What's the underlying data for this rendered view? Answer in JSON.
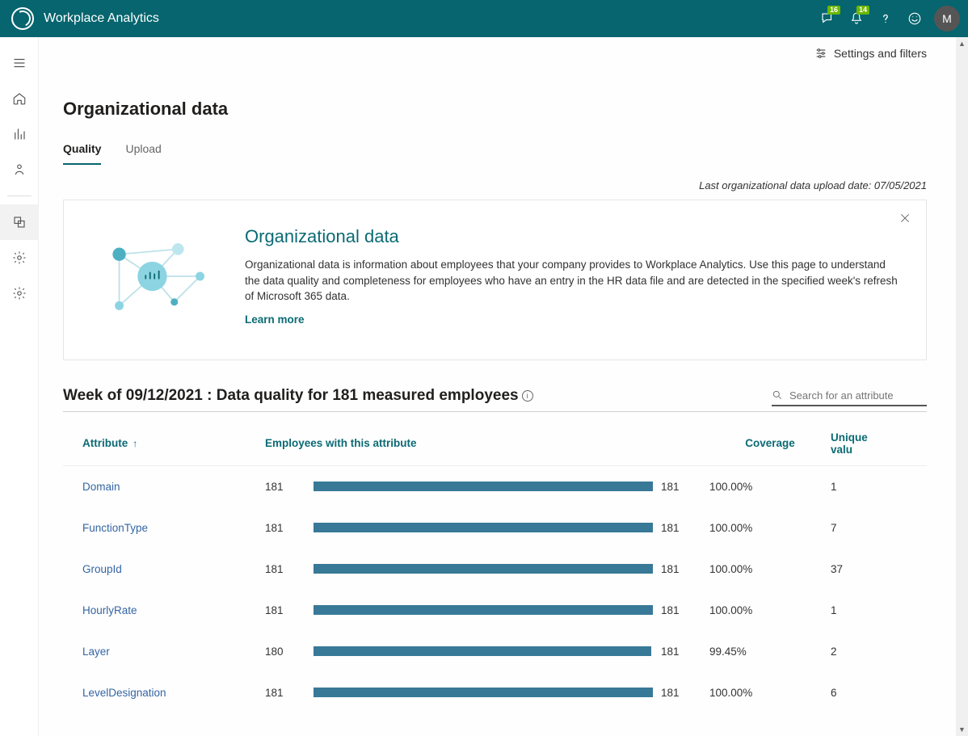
{
  "app_name": "Workplace Analytics",
  "topbar": {
    "messages_badge": "16",
    "notif_badge": "14",
    "avatar_initial": "M"
  },
  "settings_link": "Settings and filters",
  "page_title": "Organizational data",
  "tabs": {
    "quality": "Quality",
    "upload": "Upload"
  },
  "upload_date_line": "Last organizational data upload date: 07/05/2021",
  "info_card": {
    "heading": "Organizational data",
    "body": "Organizational data is information about employees that your company provides to Workplace Analytics. Use this page to understand the data quality and completeness for employees who have an entry in the HR data file and are detected in the specified week's refresh of Microsoft 365 data.",
    "learn_more": "Learn more"
  },
  "section_heading": "Week of 09/12/2021 :  Data quality for 181 measured employees",
  "search_placeholder": "Search for an attribute",
  "table_headers": {
    "attribute": "Attribute",
    "employees": "Employees with this attribute",
    "coverage": "Coverage",
    "unique": "Unique valu"
  },
  "rows": [
    {
      "attribute": "Domain",
      "count": "181",
      "bar_pct": 100,
      "bar_label": "181",
      "coverage": "100.00%",
      "unique": "1"
    },
    {
      "attribute": "FunctionType",
      "count": "181",
      "bar_pct": 100,
      "bar_label": "181",
      "coverage": "100.00%",
      "unique": "7"
    },
    {
      "attribute": "GroupId",
      "count": "181",
      "bar_pct": 100,
      "bar_label": "181",
      "coverage": "100.00%",
      "unique": "37"
    },
    {
      "attribute": "HourlyRate",
      "count": "181",
      "bar_pct": 100,
      "bar_label": "181",
      "coverage": "100.00%",
      "unique": "1"
    },
    {
      "attribute": "Layer",
      "count": "180",
      "bar_pct": 99.45,
      "bar_label": "181",
      "coverage": "99.45%",
      "unique": "2"
    },
    {
      "attribute": "LevelDesignation",
      "count": "181",
      "bar_pct": 100,
      "bar_label": "181",
      "coverage": "100.00%",
      "unique": "6"
    }
  ],
  "chart_data": {
    "type": "bar",
    "title": "Data quality for 181 measured employees (Week of 09/12/2021)",
    "xlabel": "Employees with this attribute",
    "ylabel": "Attribute",
    "xlim": [
      0,
      181
    ],
    "categories": [
      "Domain",
      "FunctionType",
      "GroupId",
      "HourlyRate",
      "Layer",
      "LevelDesignation"
    ],
    "values": [
      181,
      181,
      181,
      181,
      180,
      181
    ],
    "coverage_pct": [
      100.0,
      100.0,
      100.0,
      100.0,
      99.45,
      100.0
    ],
    "unique_values": [
      1,
      7,
      37,
      1,
      2,
      6
    ]
  }
}
